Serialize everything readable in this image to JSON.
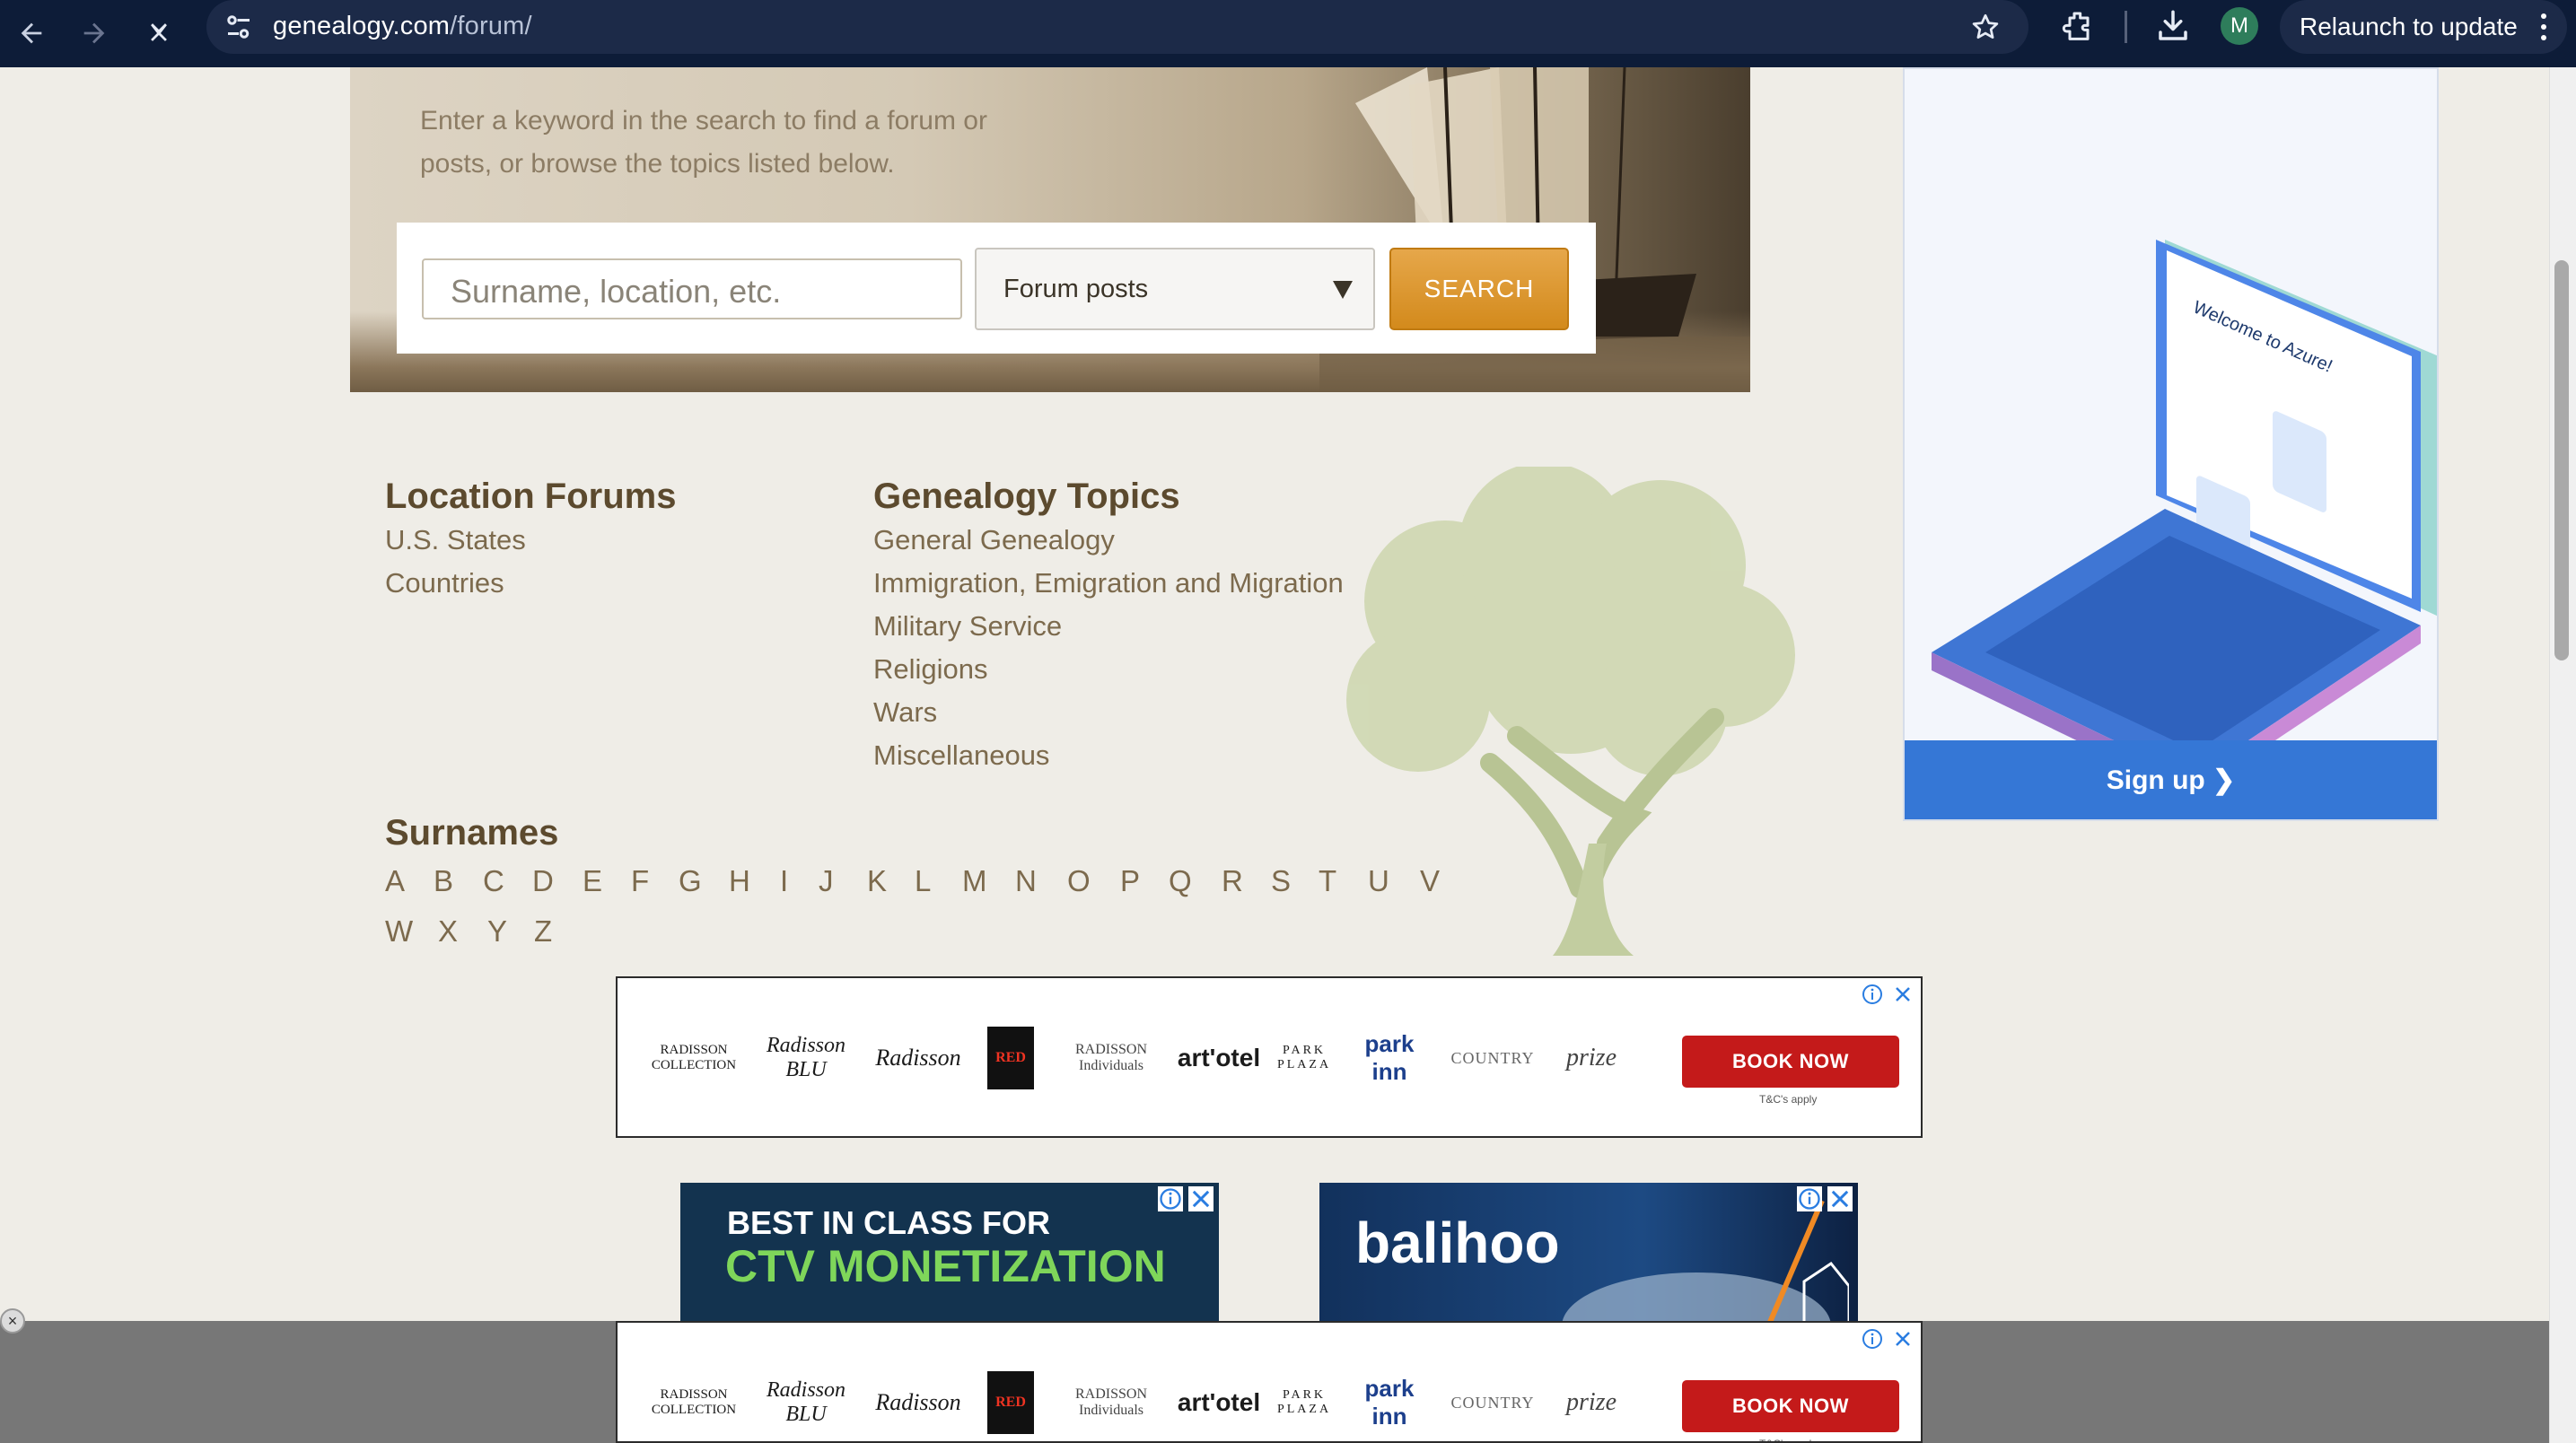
{
  "browser": {
    "url_host": "genealogy.com",
    "url_path": "/forum/",
    "avatar_letter": "M",
    "relaunch_label": "Relaunch to update",
    "icons": [
      "back-arrow-icon",
      "forward-arrow-icon",
      "stop-loading-icon",
      "site-info-icon",
      "bookmark-star-icon",
      "extensions-icon",
      "download-icon",
      "more-menu-icon"
    ]
  },
  "hero": {
    "intro": "Enter a keyword in the search to find a forum or posts, or browse the topics listed below.",
    "search_placeholder": "Surname, location, etc.",
    "search_scope_selected": "Forum posts",
    "search_button": "SEARCH"
  },
  "location_forums": {
    "heading": "Location Forums",
    "links": [
      "U.S. States",
      "Countries"
    ]
  },
  "genealogy_topics": {
    "heading": "Genealogy Topics",
    "links": [
      "General Genealogy",
      "Immigration, Emigration and Migration",
      "Military Service",
      "Religions",
      "Wars",
      "Miscellaneous"
    ]
  },
  "surnames": {
    "heading": "Surnames",
    "letters": [
      "A",
      "B",
      "C",
      "D",
      "E",
      "F",
      "G",
      "H",
      "I",
      "J",
      "K",
      "L",
      "M",
      "N",
      "O",
      "P",
      "Q",
      "R",
      "S",
      "T",
      "U",
      "V",
      "W",
      "X",
      "Y",
      "Z"
    ]
  },
  "side_ad": {
    "headline": "Welcome to Azure!",
    "cta": "Sign up ❯"
  },
  "radisson_ad": {
    "brands": [
      "RADISSON COLLECTION",
      "Radisson BLU",
      "Radisson",
      "RED",
      "RADISSON Individuals",
      "art'otel",
      "PARK PLAZA",
      "park inn",
      "COUNTRY",
      "prize"
    ],
    "cta": "BOOK NOW",
    "terms": "T&C's apply"
  },
  "ctv_ad": {
    "line1": "BEST IN CLASS FOR",
    "line2": "CTV MONETIZATION"
  },
  "balihoo_ad": {
    "brand": "balihoo"
  },
  "colors": {
    "chrome_bg": "#0d1c38",
    "heading_brown": "#5c4a2e",
    "link_brown": "#7c6a4d",
    "search_orange": "#d38a1c",
    "azure_blue": "#3577d6",
    "book_red": "#c41a1a",
    "page_bg": "#efede7"
  }
}
